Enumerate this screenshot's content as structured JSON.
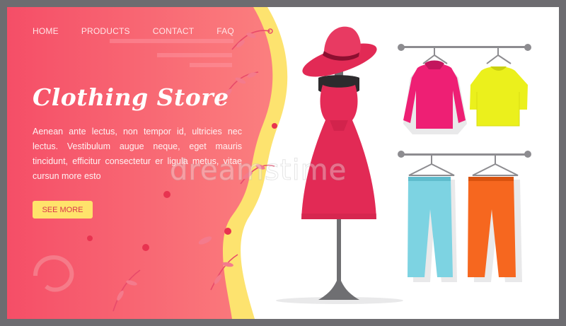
{
  "nav": {
    "items": [
      "HOME",
      "PRODUCTS",
      "CONTACT",
      "FAQ"
    ]
  },
  "hero": {
    "title": "Clothing Store",
    "text": "Aenean ante lectus, non tempor id, ultricies nec lectus. Vestibulum augue neque, eget mauris tincidunt, efficitur consectetur er ligula metus, vitae cursun more esto",
    "cta_label": "SEE MORE"
  },
  "watermark": {
    "text": "dreamstime"
  },
  "colors": {
    "hero_pink": "#f54e67",
    "hero_coral": "#fb7f7f",
    "wave_yellow": "#fde36f",
    "button_yellow": "#ffe36b",
    "dress_red": "#e52b57",
    "sweater_magenta": "#ee1f74",
    "tshirt_yellow": "#ebf01c",
    "jeans_blue": "#7dd3e2",
    "pants_orange": "#f6671f",
    "frame_gray": "#6d6c70"
  },
  "icons": [
    "leaf-branch-icon",
    "spiral-swirl-icon"
  ]
}
